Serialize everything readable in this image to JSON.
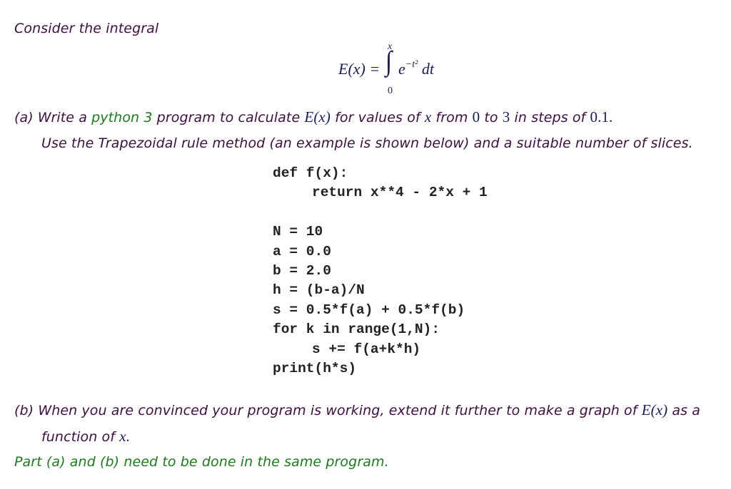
{
  "colors": {
    "text": "#3d0f40",
    "highlight_green": "#1e7a1e",
    "math": "#1a1a5e",
    "code": "#222222",
    "background": "#ffffff"
  },
  "intro": {
    "text": "Consider the integral"
  },
  "equation": {
    "lhs": "E(x) =",
    "integral_symbol": "∫",
    "upper_limit": "x",
    "lower_limit": "0",
    "integrand_base": "e",
    "integrand_exponent": "−t²",
    "differential": "dt"
  },
  "part_a": {
    "prefix": "(a) Write a",
    "highlight": "python 3",
    "middle": "program to calculate",
    "function": "E(x)",
    "for_values": "for values of",
    "var": "x",
    "from": "from",
    "start": "0",
    "to": "to",
    "end": "3",
    "steps": "in steps of",
    "step": "0.1.",
    "line2": "Use the Trapezoidal rule method (an example is shown below) and a suitable number of slices."
  },
  "code": {
    "lines": [
      {
        "text": "def f(x):",
        "indent": false
      },
      {
        "text": "return x**4 - 2*x + 1",
        "indent": true
      },
      {
        "text": "",
        "indent": false
      },
      {
        "text": "N = 10",
        "indent": false
      },
      {
        "text": "a = 0.0",
        "indent": false
      },
      {
        "text": "b = 2.0",
        "indent": false
      },
      {
        "text": "h = (b-a)/N",
        "indent": false
      },
      {
        "text": "s = 0.5*f(a) + 0.5*f(b)",
        "indent": false
      },
      {
        "text": "for k in range(1,N):",
        "indent": false
      },
      {
        "text": "s += f(a+k*h)",
        "indent": true
      },
      {
        "text": "print(h*s)",
        "indent": false
      }
    ]
  },
  "part_b": {
    "line1_prefix": "(b) When you are convinced your program is working, extend it further to make a graph of",
    "function": "E(x)",
    "line1_suffix": "as a",
    "line2_prefix": "function of",
    "var": "x",
    "line2_suffix": "."
  },
  "note": {
    "text": "Part (a) and (b) need to be done in the same program."
  }
}
